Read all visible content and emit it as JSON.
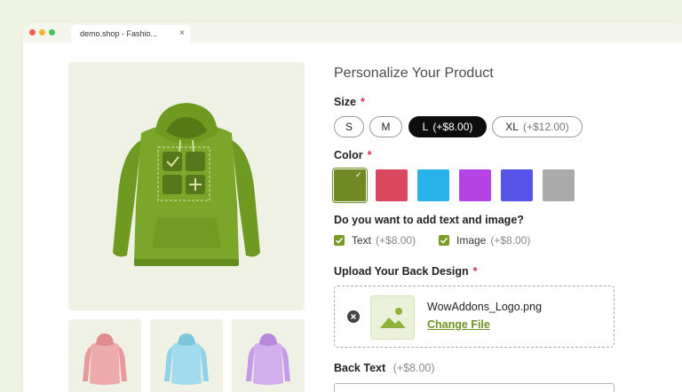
{
  "browser": {
    "tab_title": "demo.shop - Fashio...",
    "close_glyph": "×"
  },
  "gallery": {
    "main_color": "#7aa32a",
    "thumb_colors": [
      "#e89a9a",
      "#8fd3e8",
      "#c59ae6"
    ]
  },
  "product": {
    "title": "Personalize Your Product",
    "required_mark": "*",
    "size": {
      "label": "Size",
      "options": [
        {
          "name": "S",
          "price": ""
        },
        {
          "name": "M",
          "price": ""
        },
        {
          "name": "L",
          "price": "(+$8.00)",
          "selected": true
        },
        {
          "name": "XL",
          "price": "(+$12.00)"
        }
      ]
    },
    "color": {
      "label": "Color",
      "swatches": [
        {
          "name": "green",
          "hex": "#6f8a25",
          "selected": true
        },
        {
          "name": "red",
          "hex": "#d9485f"
        },
        {
          "name": "sky-blue",
          "hex": "#29b2ea"
        },
        {
          "name": "purple",
          "hex": "#b643e6"
        },
        {
          "name": "indigo",
          "hex": "#5553e8"
        },
        {
          "name": "gray",
          "hex": "#aaaaaa"
        }
      ],
      "check_glyph": "✓"
    },
    "addons": {
      "question": "Do you want to add text and image?",
      "options": [
        {
          "label": "Text",
          "price": "(+$8.00)",
          "checked": true
        },
        {
          "label": "Image",
          "price": "(+$8.00)",
          "checked": true
        }
      ]
    },
    "upload": {
      "label": "Upload Your Back Design",
      "file_name": "WowAddons_Logo.png",
      "change_label": "Change File"
    },
    "back_text": {
      "label": "Back Text",
      "price": "(+$8.00)",
      "value": ""
    }
  }
}
